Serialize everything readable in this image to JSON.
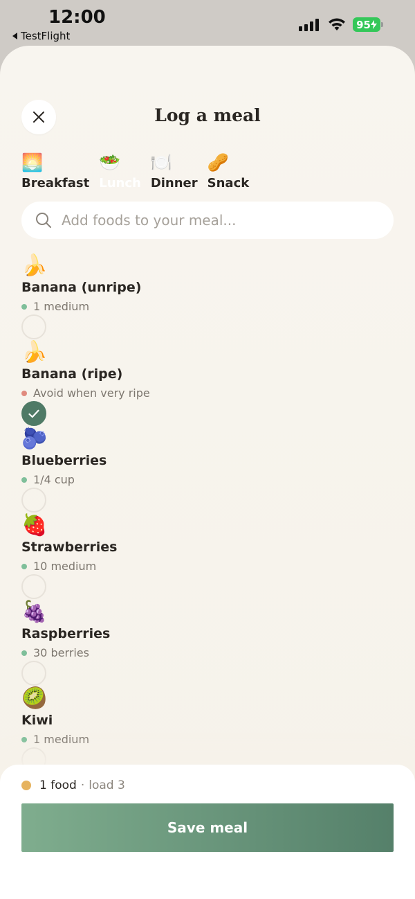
{
  "status_bar": {
    "time": "12:00",
    "back_app": "TestFlight",
    "battery": "95"
  },
  "header": {
    "title": "Log a meal",
    "close_icon": "close-icon"
  },
  "meal_tabs": [
    {
      "emoji": "🌅",
      "label": "Breakfast",
      "active": false
    },
    {
      "emoji": "🥗",
      "label": "Lunch",
      "active": true
    },
    {
      "emoji": "🍽️",
      "label": "Dinner",
      "active": false
    },
    {
      "emoji": "🥜",
      "label": "Snack",
      "active": false
    }
  ],
  "search": {
    "placeholder": "Add foods to your meal...",
    "icon": "search-icon"
  },
  "foods": [
    {
      "emoji": "🍌",
      "name": "Banana (unripe)",
      "meta": "1 medium",
      "status": "ok",
      "selected": false
    },
    {
      "emoji": "🍌",
      "name": "Banana (ripe)",
      "meta": "Avoid when very ripe",
      "status": "warn",
      "selected": true
    },
    {
      "emoji": "🫐",
      "name": "Blueberries",
      "meta": "1/4 cup",
      "status": "ok",
      "selected": false
    },
    {
      "emoji": "🍓",
      "name": "Strawberries",
      "meta": "10 medium",
      "status": "ok",
      "selected": false
    },
    {
      "emoji": "🍇",
      "name": "Raspberries",
      "meta": "30 berries",
      "status": "ok",
      "selected": false
    },
    {
      "emoji": "🥝",
      "name": "Kiwi",
      "meta": "1 medium",
      "status": "ok",
      "selected": false
    }
  ],
  "summary": {
    "count": "1 food",
    "separator": "·",
    "load": "load 3"
  },
  "save_label": "Save meal",
  "colors": {
    "accent": "#4f7a66",
    "ok_dot": "#7fbf9a",
    "warn_dot": "#e08a7e",
    "summary_dot": "#e6b35f",
    "button_left": "#7fad8e",
    "button_right": "#55806a",
    "battery": "#34c759"
  }
}
